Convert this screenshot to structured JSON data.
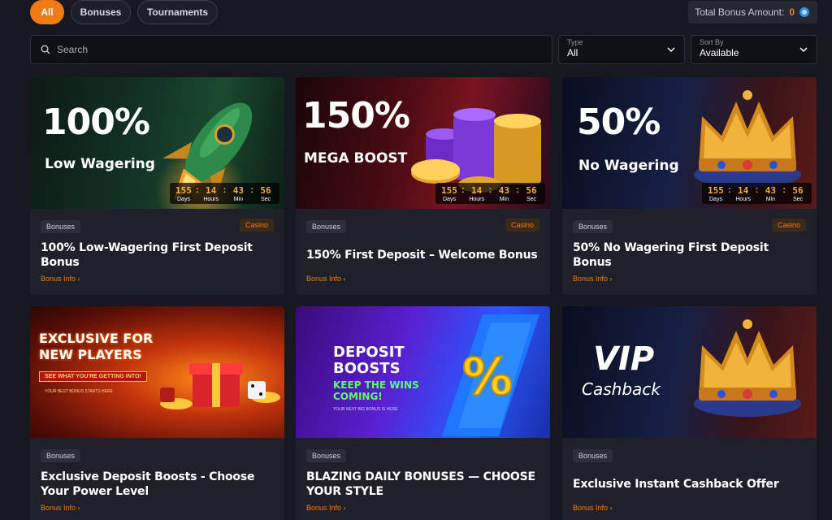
{
  "filters": {
    "all": "All",
    "bonuses": "Bonuses",
    "tournaments": "Tournaments"
  },
  "total_bonus": {
    "label": "Total Bonus Amount:",
    "value": "0"
  },
  "search": {
    "placeholder": "Search"
  },
  "type_select": {
    "label": "Type",
    "value": "All"
  },
  "sort_select": {
    "label": "Sort By",
    "value": "Available"
  },
  "timer_units": {
    "days": "Days",
    "hours": "Hours",
    "min": "Min",
    "sec": "Sec"
  },
  "cards": [
    {
      "banner_pct": "100%",
      "banner_sub": "Low Wagering",
      "timer": {
        "days": "155",
        "hours": "14",
        "min": "43",
        "sec": "56"
      },
      "tag": "Bonuses",
      "casino": "Casino",
      "title": "100% Low-Wagering First Deposit Bonus",
      "link": "Bonus Info ›"
    },
    {
      "banner_pct": "150%",
      "banner_sub": "MEGA BOOST",
      "timer": {
        "days": "155",
        "hours": "14",
        "min": "43",
        "sec": "56"
      },
      "tag": "Bonuses",
      "casino": "Casino",
      "title": "150% First Deposit – Welcome Bonus",
      "link": "Bonus Info ›"
    },
    {
      "banner_pct": "50%",
      "banner_sub": "No Wagering",
      "timer": {
        "days": "155",
        "hours": "14",
        "min": "43",
        "sec": "56"
      },
      "tag": "Bonuses",
      "casino": "Casino",
      "title": "50% No Wagering First Deposit Bonus",
      "link": "Bonus Info ›"
    },
    {
      "banner_line1": "EXCLUSIVE FOR",
      "banner_line2": "NEW PLAYERS",
      "banner_cta": "SEE WHAT YOU'RE GETTING INTO!",
      "banner_small": "YOUR BEST BONUS STARTS HERE",
      "tag": "Bonuses",
      "title": "Exclusive Deposit Boosts - Choose Your Power Level",
      "link": "Bonus Info ›"
    },
    {
      "banner_line1": "DEPOSIT",
      "banner_line2": "BOOSTS",
      "banner_line3": "KEEP THE WINS",
      "banner_line4": "COMING!",
      "banner_small": "YOUR NEXT BIG BONUS IS HERE",
      "tag": "Bonuses",
      "title": "BLAZING DAILY BONUSES — CHOOSE YOUR STYLE",
      "link": "Bonus Info ›"
    },
    {
      "banner_line1": "VIP",
      "banner_line2": "Cashback",
      "tag": "Bonuses",
      "title": "Exclusive Instant Cashback Offer",
      "link": "Bonus Info ›"
    }
  ],
  "colors": {
    "accent": "#f07b12",
    "background": "#17181f",
    "card": "#1f2029"
  }
}
